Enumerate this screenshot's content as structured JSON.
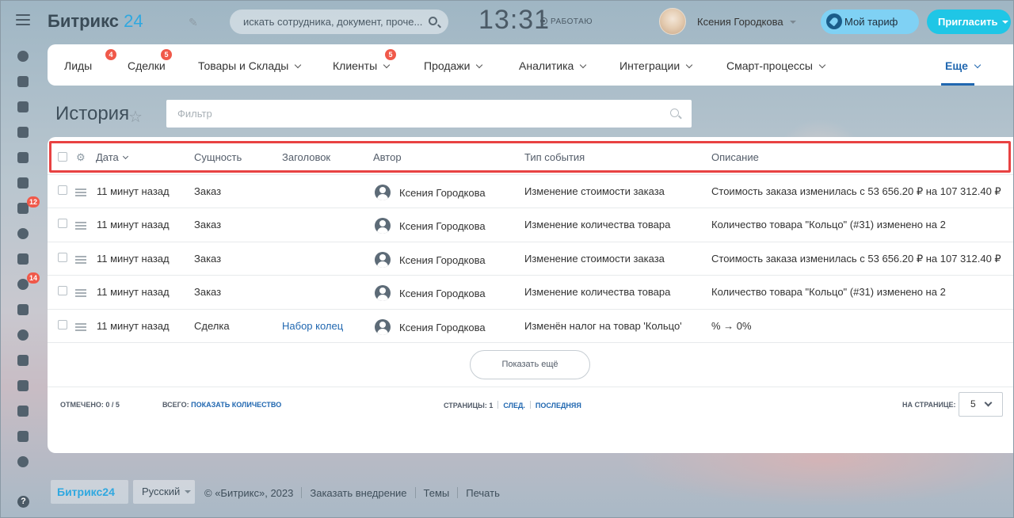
{
  "header": {
    "logo_text": "Битрикс",
    "logo_num": "24",
    "search_placeholder": "искать сотрудника, документ, проче...",
    "clock": "13:31",
    "work_status": "РАБОТАЮ",
    "user_name": "Ксения Городкова",
    "tariff_label": "Мой тариф",
    "invite_label": "Пригласить"
  },
  "rail": {
    "badges": [
      "12",
      "14"
    ]
  },
  "nav": {
    "items": [
      {
        "label": "Лиды",
        "badge": "4"
      },
      {
        "label": "Сделки",
        "badge": "5"
      },
      {
        "label": "Товары и Склады"
      },
      {
        "label": "Клиенты",
        "badge": "5"
      },
      {
        "label": "Продажи"
      },
      {
        "label": "Аналитика"
      },
      {
        "label": "Интеграции"
      },
      {
        "label": "Смарт-процессы"
      },
      {
        "label": "Еще"
      }
    ]
  },
  "page": {
    "title": "История",
    "filter_placeholder": "Фильтр"
  },
  "table": {
    "columns": [
      "Дата",
      "Сущность",
      "Заголовок",
      "Автор",
      "Тип события",
      "Описание"
    ],
    "rows": [
      {
        "date": "11 минут назад",
        "entity": "Заказ",
        "title": "",
        "author": "Ксения Городкова",
        "event": "Изменение стоимости заказа",
        "description": "Стоимость заказа изменилась с 53 656.20 ₽ на 107 312.40 ₽"
      },
      {
        "date": "11 минут назад",
        "entity": "Заказ",
        "title": "",
        "author": "Ксения Городкова",
        "event": "Изменение количества товара",
        "description": "Количество товара \"Кольцо\" (#31) изменено на 2"
      },
      {
        "date": "11 минут назад",
        "entity": "Заказ",
        "title": "",
        "author": "Ксения Городкова",
        "event": "Изменение стоимости заказа",
        "description": "Стоимость заказа изменилась с 53 656.20 ₽ на 107 312.40 ₽"
      },
      {
        "date": "11 минут назад",
        "entity": "Заказ",
        "title": "",
        "author": "Ксения Городкова",
        "event": "Изменение количества товара",
        "description": "Количество товара \"Кольцо\" (#31) изменено на 2"
      },
      {
        "date": "11 минут назад",
        "entity": "Сделка",
        "title": "Набор колец",
        "author": "Ксения Городкова",
        "event": "Изменён налог на товар 'Кольцо'",
        "description": "% → 0%"
      }
    ],
    "show_more": "Показать ещё",
    "footer": {
      "marked_label": "ОТМЕЧЕНО:",
      "marked_value": "0 / 5",
      "total_label": "ВСЕГО:",
      "total_link": "ПОКАЗАТЬ КОЛИЧЕСТВО",
      "pages_label": "СТРАНИЦЫ:",
      "pages_value": "1",
      "next": "СЛЕД.",
      "last": "ПОСЛЕДНЯЯ",
      "per_page_label": "НА СТРАНИЦЕ:",
      "per_page_value": "5"
    }
  },
  "footer": {
    "logo": "Битрикс24",
    "language": "Русский",
    "copyright": "© «Битрикс», 2023",
    "order": "Заказать внедрение",
    "themes": "Темы",
    "print": "Печать"
  }
}
